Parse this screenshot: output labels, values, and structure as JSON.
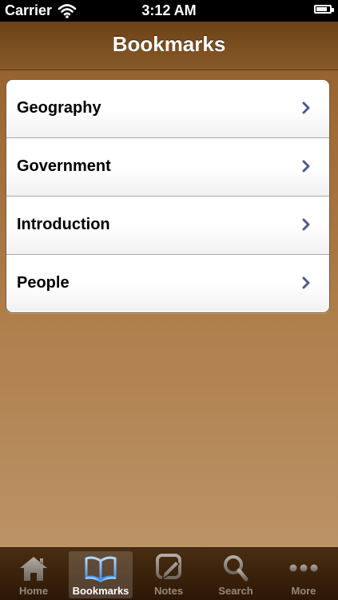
{
  "status_bar": {
    "carrier": "Carrier",
    "time": "3:12 AM",
    "battery_level": 0.95
  },
  "nav": {
    "title": "Bookmarks"
  },
  "bookmarks": [
    {
      "label": "Geography"
    },
    {
      "label": "Government"
    },
    {
      "label": "Introduction"
    },
    {
      "label": "People"
    }
  ],
  "tabs": [
    {
      "label": "Home",
      "icon": "house-icon",
      "selected": false
    },
    {
      "label": "Bookmarks",
      "icon": "book-icon",
      "selected": true
    },
    {
      "label": "Notes",
      "icon": "notes-icon",
      "selected": false
    },
    {
      "label": "Search",
      "icon": "magnifier-icon",
      "selected": false
    },
    {
      "label": "More",
      "icon": "ellipsis-icon",
      "selected": false
    }
  ],
  "colors": {
    "nav_bar": "#7d4f20",
    "background": "#a06b37",
    "chevron": "#4f5a8c",
    "selected_tab_icon": "#6db3ff"
  }
}
